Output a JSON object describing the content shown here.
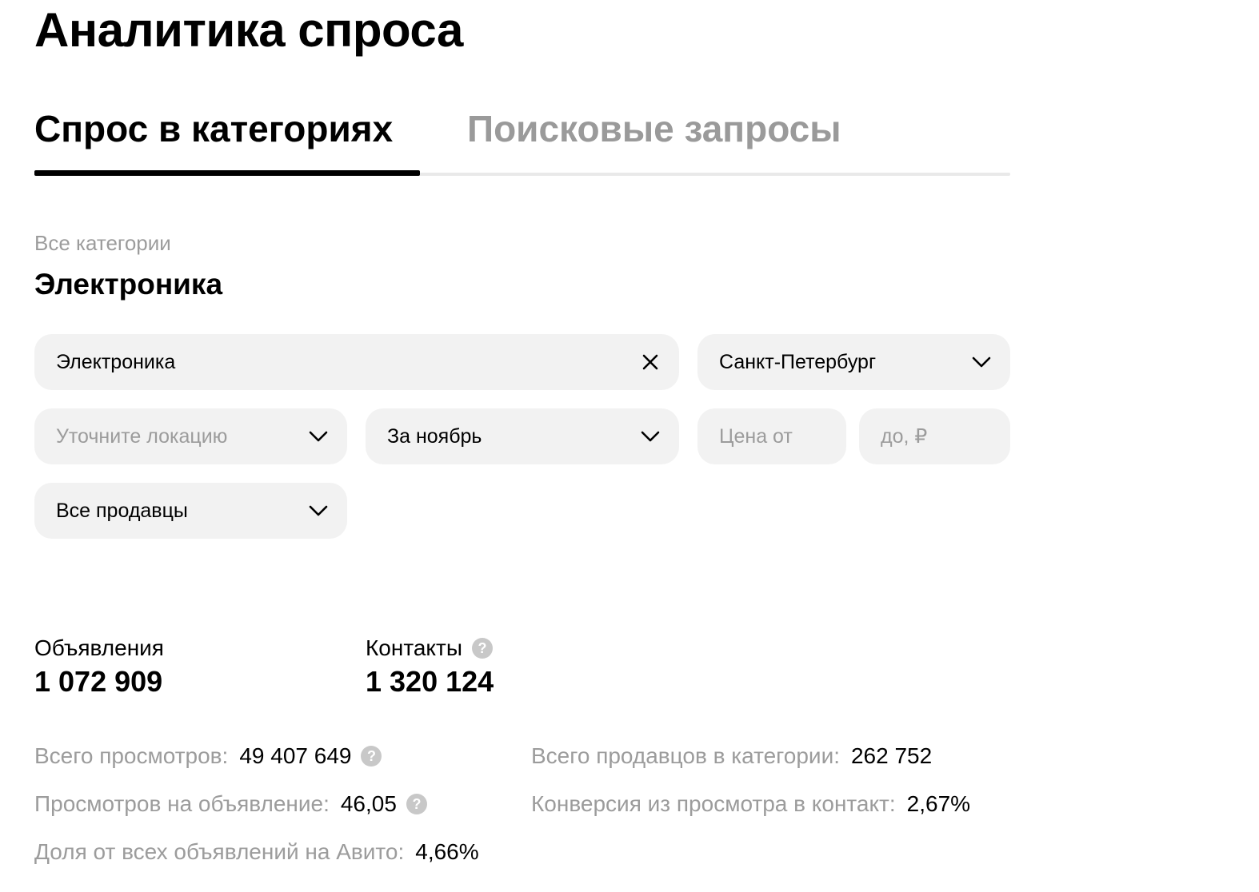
{
  "page": {
    "title": "Аналитика спроса"
  },
  "tabs": [
    {
      "label": "Спрос в категориях",
      "active": true
    },
    {
      "label": "Поисковые запросы",
      "active": false
    }
  ],
  "breadcrumb": "Все категории",
  "section_title": "Электроника",
  "filters": {
    "category": {
      "value": "Электроника"
    },
    "region": {
      "value": "Санкт-Петербург"
    },
    "location": {
      "placeholder": "Уточните локацию"
    },
    "period": {
      "value": "За ноябрь"
    },
    "price_from": {
      "placeholder": "Цена от"
    },
    "price_to": {
      "placeholder": "до, ₽"
    },
    "sellers": {
      "value": "Все продавцы"
    }
  },
  "stats": {
    "listings": {
      "label": "Объявления",
      "value": "1 072 909"
    },
    "contacts": {
      "label": "Контакты",
      "value": "1 320 124"
    }
  },
  "metrics": {
    "total_views": {
      "label": "Всего просмотров:",
      "value": "49 407 649"
    },
    "views_per_listing": {
      "label": "Просмотров на объявление:",
      "value": "46,05"
    },
    "share_of_all": {
      "label": "Доля от всех объявлений на Авито:",
      "value": "4,66%"
    },
    "total_sellers": {
      "label": "Всего продавцов в категории:",
      "value": "262 752"
    },
    "conversion": {
      "label": "Конверсия из просмотра в контакт:",
      "value": "2,67%"
    }
  },
  "icons": {
    "help": "question-mark",
    "clear": "close-x",
    "dropdown": "chevron-down"
  },
  "colors": {
    "text": "#000000",
    "muted": "#9c9c9c",
    "field_bg": "#f2f2f2",
    "help_icon_bg": "#c8c8c8",
    "tab_line": "#e9e9e9"
  }
}
